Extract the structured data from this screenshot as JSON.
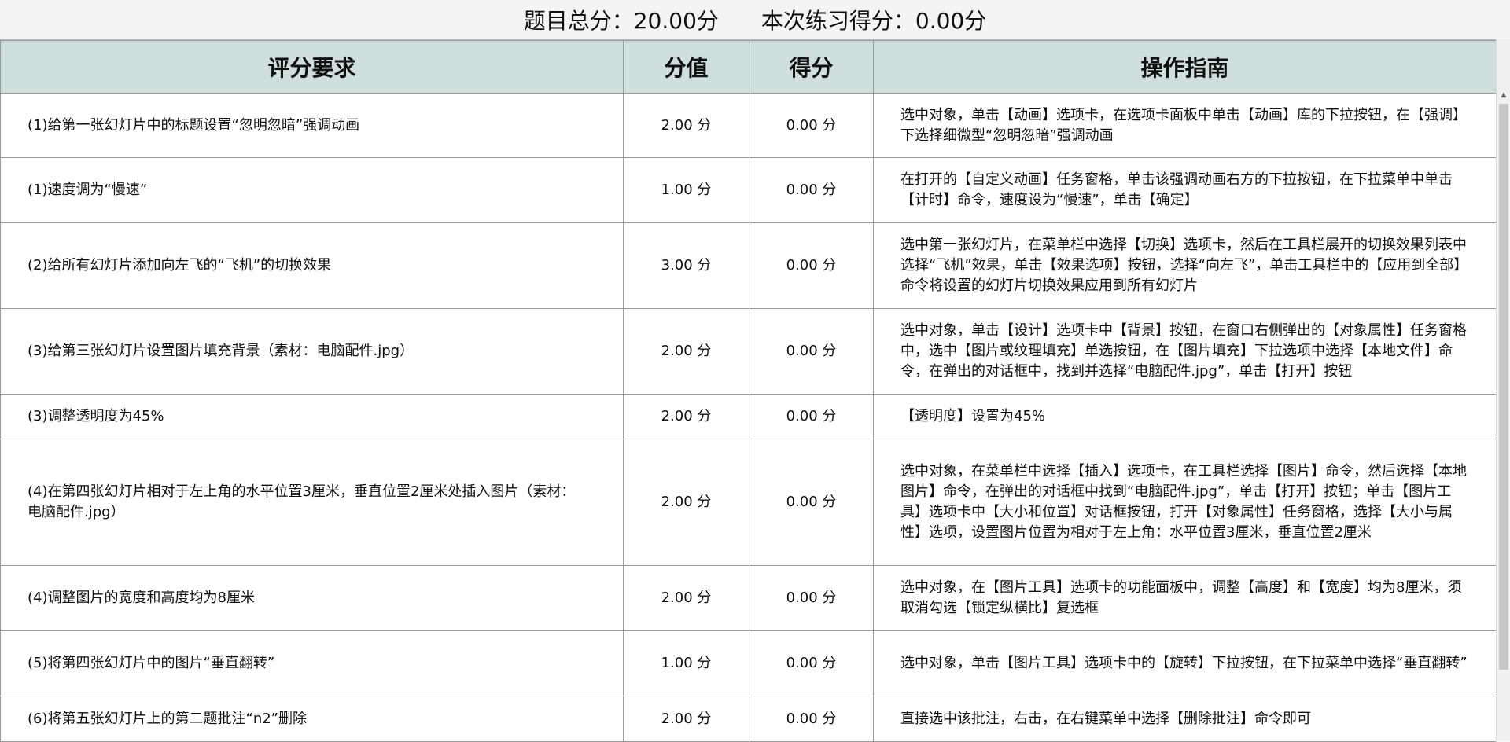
{
  "header": {
    "total_label": "题目总分：20.00分",
    "score_label": "本次练习得分：0.00分"
  },
  "table": {
    "columns": [
      "评分要求",
      "分值",
      "得分",
      "操作指南"
    ],
    "rows": [
      {
        "requirement": "(1)给第一张幻灯片中的标题设置“忽明忽暗”强调动画",
        "points": "2.00 分",
        "score": "0.00 分",
        "guide": "选中对象，单击【动画】选项卡，在选项卡面板中单击【动画】库的下拉按钮，在【强调】下选择细微型“忽明忽暗”强调动画"
      },
      {
        "requirement": "(1)速度调为“慢速”",
        "points": "1.00 分",
        "score": "0.00 分",
        "guide": "在打开的【自定义动画】任务窗格，单击该强调动画右方的下拉按钮，在下拉菜单中单击【计时】命令，速度设为“慢速”，单击【确定】"
      },
      {
        "requirement": "(2)给所有幻灯片添加向左飞的“飞机”的切换效果",
        "points": "3.00 分",
        "score": "0.00 分",
        "guide": "选中第一张幻灯片，在菜单栏中选择【切换】选项卡，然后在工具栏展开的切换效果列表中选择“飞机”效果，单击【效果选项】按钮，选择“向左飞”，单击工具栏中的【应用到全部】命令将设置的幻灯片切换效果应用到所有幻灯片"
      },
      {
        "requirement": "(3)给第三张幻灯片设置图片填充背景（素材：电脑配件.jpg）",
        "points": "2.00 分",
        "score": "0.00 分",
        "guide": "选中对象，单击【设计】选项卡中【背景】按钮，在窗口右侧弹出的【对象属性】任务窗格中，选中【图片或纹理填充】单选按钮，在【图片填充】下拉选项中选择【本地文件】命令，在弹出的对话框中，找到并选择“电脑配件.jpg”，单击【打开】按钮"
      },
      {
        "requirement": "(3)调整透明度为45%",
        "points": "2.00 分",
        "score": "0.00 分",
        "guide": "【透明度】设置为45%"
      },
      {
        "requirement": "(4)在第四张幻灯片相对于左上角的水平位置3厘米，垂直位置2厘米处插入图片（素材：电脑配件.jpg）",
        "points": "2.00 分",
        "score": "0.00 分",
        "guide": "选中对象，在菜单栏中选择【插入】选项卡，在工具栏选择【图片】命令，然后选择【本地图片】命令，在弹出的对话框中找到“电脑配件.jpg”，单击【打开】按钮；单击【图片工具】选项卡中【大小和位置】对话框按钮，打开【对象属性】任务窗格，选择【大小与属性】选项，设置图片位置为相对于左上角：水平位置3厘米，垂直位置2厘米"
      },
      {
        "requirement": "(4)调整图片的宽度和高度均为8厘米",
        "points": "2.00 分",
        "score": "0.00 分",
        "guide": "选中对象，在【图片工具】选项卡的功能面板中，调整【高度】和【宽度】均为8厘米，须取消勾选【锁定纵横比】复选框"
      },
      {
        "requirement": "(5)将第四张幻灯片中的图片“垂直翻转”",
        "points": "1.00 分",
        "score": "0.00 分",
        "guide": "选中对象，单击【图片工具】选项卡中的【旋转】下拉按钮，在下拉菜单中选择“垂直翻转”"
      },
      {
        "requirement": "(6)将第五张幻灯片上的第二题批注“n2”删除",
        "points": "2.00 分",
        "score": "0.00 分",
        "guide": "直接选中该批注，右击，在右键菜单中选择【删除批注】命令即可"
      }
    ]
  },
  "icons": {
    "scroll_up": "scroll-up-arrow-icon"
  }
}
